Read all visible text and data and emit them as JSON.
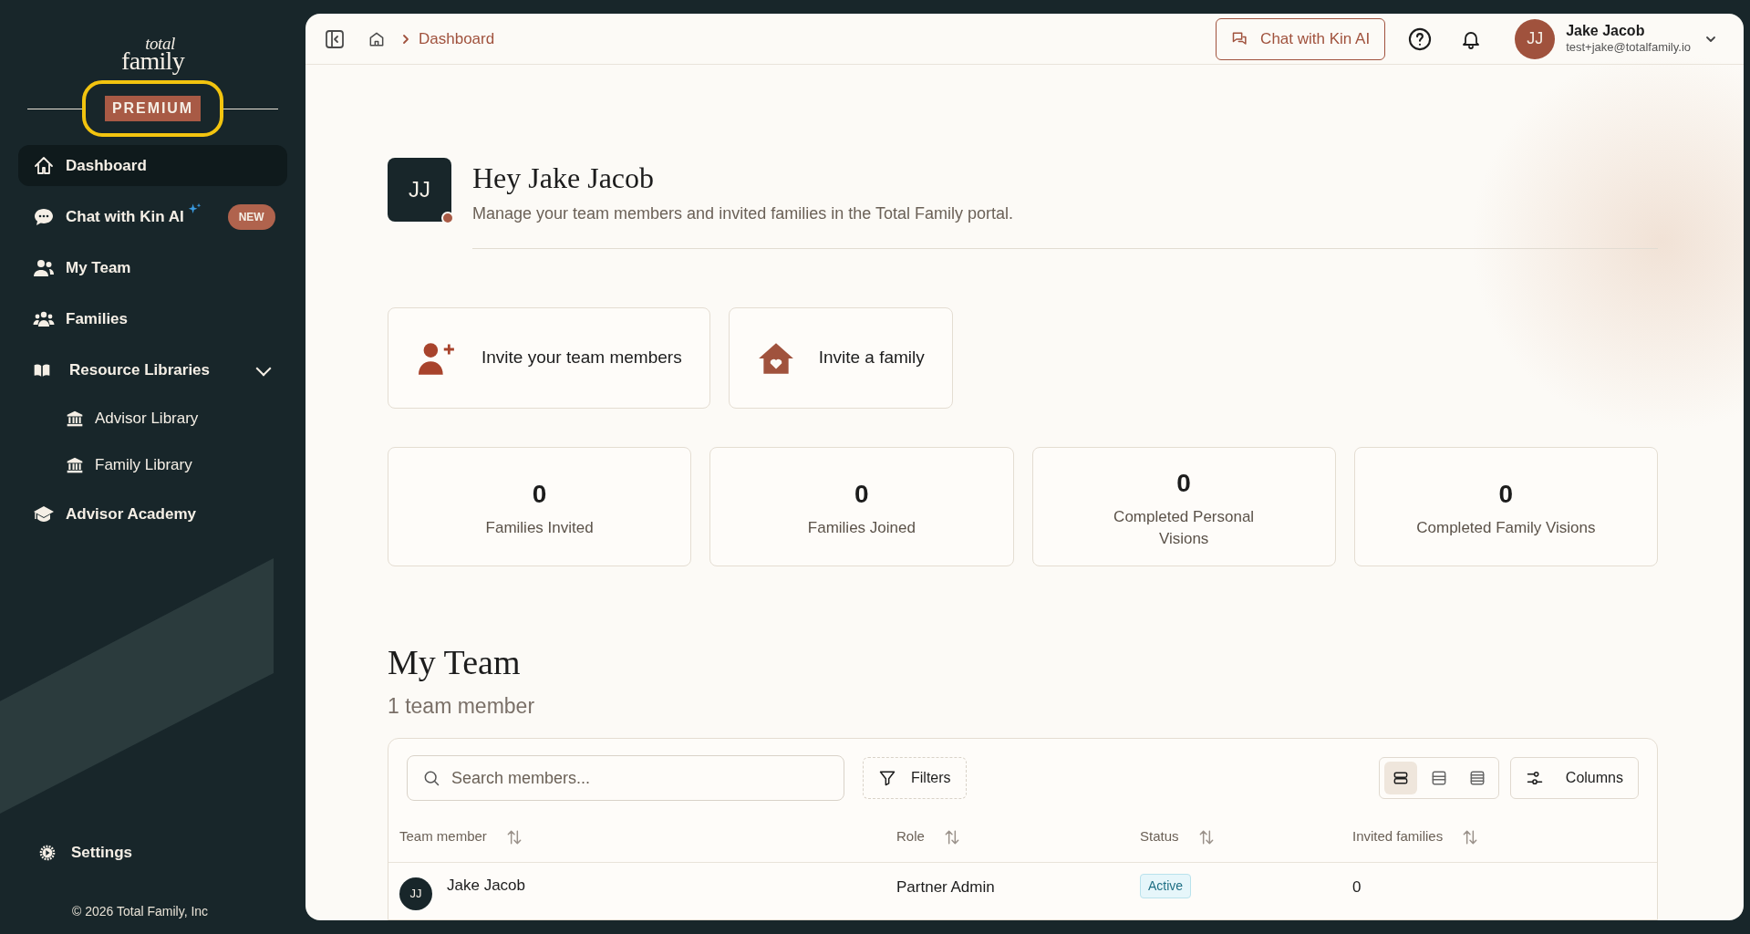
{
  "sidebar": {
    "logo": {
      "top": "total",
      "bottom": "family"
    },
    "plan_badge": "PREMIUM",
    "items": [
      {
        "kind": "home",
        "label": "Dashboard",
        "selected": true
      },
      {
        "kind": "chat",
        "label": "Chat with Kin AI",
        "badge": "NEW",
        "selected": false
      },
      {
        "kind": "team",
        "label": "My Team",
        "selected": false
      },
      {
        "kind": "families",
        "label": "Families",
        "selected": false
      },
      {
        "kind": "book",
        "label": "Resource Libraries",
        "expanded": true,
        "selected": false,
        "children": [
          {
            "kind": "bank",
            "label": "Advisor Library",
            "selected": false
          },
          {
            "kind": "bank",
            "label": "Family Library",
            "selected": false
          }
        ]
      },
      {
        "kind": "academy",
        "label": "Advisor Academy",
        "selected": false
      }
    ],
    "settings": "Settings",
    "copyright": "© 2026 Total Family, Inc"
  },
  "header": {
    "breadcrumb": "Dashboard",
    "chat_button": "Chat with Kin AI",
    "user": {
      "initials": "JJ",
      "name": "Jake Jacob",
      "email": "test+jake@totalfamily.io"
    }
  },
  "greeting": {
    "initials": "JJ",
    "title": "Hey Jake Jacob",
    "subtitle": "Manage your team members and invited families in the Total Family portal."
  },
  "actions": [
    {
      "kind": "person-add",
      "label": "Invite your team members"
    },
    {
      "kind": "house",
      "label": "Invite a family"
    }
  ],
  "stats": [
    {
      "value": "0",
      "label": "Families Invited"
    },
    {
      "value": "0",
      "label": "Families Joined"
    },
    {
      "value": "0",
      "label": "Completed Personal Visions"
    },
    {
      "value": "0",
      "label": "Completed Family Visions"
    }
  ],
  "team": {
    "title": "My Team",
    "count": "1 team member",
    "search": {
      "placeholder": "Search members..."
    },
    "filters": "Filters",
    "columns_button": "Columns",
    "view_modes": [
      {
        "selected": true
      },
      {
        "selected": false
      },
      {
        "selected": false
      }
    ],
    "columns": [
      "Team member",
      "Role",
      "Status",
      "Invited families"
    ],
    "rows": [
      {
        "initials": "JJ",
        "name": "Jake Jacob",
        "role": "Partner Admin",
        "status": "Active",
        "invited_families": "0"
      }
    ]
  }
}
